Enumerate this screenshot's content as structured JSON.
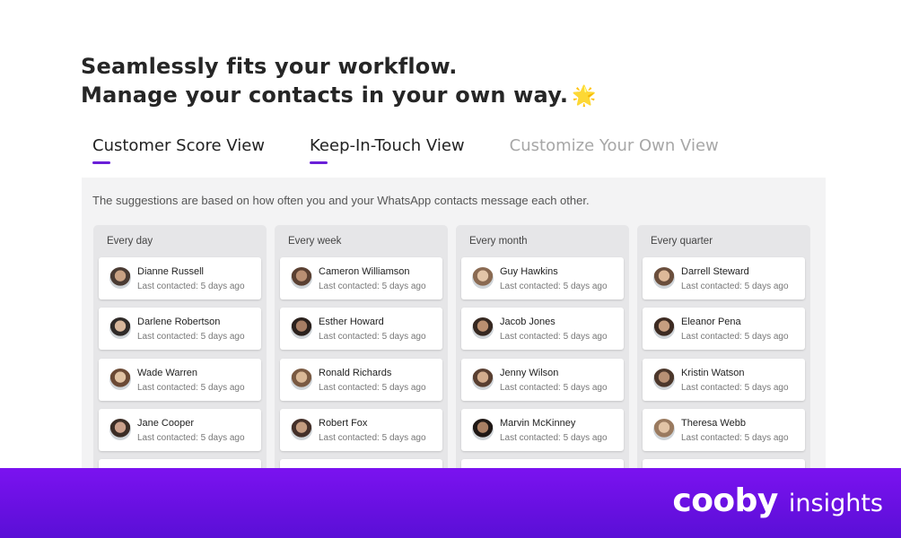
{
  "headline": {
    "line1": "Seamlessly fits your workflow.",
    "line2": "Manage your contacts in your own way.",
    "emoji": "🌟"
  },
  "tabs": [
    {
      "label": "Customer Score View",
      "active": true
    },
    {
      "label": "Keep-In-Touch View",
      "active": true
    },
    {
      "label": "Customize Your Own View",
      "active": false
    }
  ],
  "panel": {
    "note": "The suggestions are based on how often you and your WhatsApp contacts message each other.",
    "columns": [
      {
        "title": "Every day",
        "contacts": [
          {
            "name": "Dianne Russell",
            "status": "Last contacted: 5 days ago"
          },
          {
            "name": "Darlene Robertson",
            "status": "Last contacted: 5 days ago"
          },
          {
            "name": "Wade Warren",
            "status": "Last contacted: 5 days ago"
          },
          {
            "name": "Jane Cooper",
            "status": "Last contacted: 5 days ago"
          }
        ]
      },
      {
        "title": "Every week",
        "contacts": [
          {
            "name": "Cameron Williamson",
            "status": "Last contacted: 5 days ago"
          },
          {
            "name": "Esther Howard",
            "status": "Last contacted: 5 days ago"
          },
          {
            "name": "Ronald Richards",
            "status": "Last contacted: 5 days ago"
          },
          {
            "name": "Robert Fox",
            "status": "Last contacted: 5 days ago"
          }
        ]
      },
      {
        "title": "Every month",
        "contacts": [
          {
            "name": "Guy Hawkins",
            "status": "Last contacted: 5 days ago"
          },
          {
            "name": "Jacob Jones",
            "status": "Last contacted: 5 days ago"
          },
          {
            "name": "Jenny Wilson",
            "status": "Last contacted: 5 days ago"
          },
          {
            "name": "Marvin McKinney",
            "status": "Last contacted: 5 days ago"
          }
        ]
      },
      {
        "title": "Every quarter",
        "contacts": [
          {
            "name": "Darrell Steward",
            "status": "Last contacted: 5 days ago"
          },
          {
            "name": "Eleanor Pena",
            "status": "Last contacted: 5 days ago"
          },
          {
            "name": "Kristin Watson",
            "status": "Last contacted: 5 days ago"
          },
          {
            "name": "Theresa Webb",
            "status": "Last contacted: 5 days ago"
          }
        ]
      }
    ]
  },
  "footer": {
    "brand_name": "cooby",
    "brand_suffix": "insights"
  },
  "colors": {
    "accent": "#6a1fd8",
    "footer": "#6a12e6",
    "panel": "#f3f3f4",
    "column": "#e6e6e8"
  },
  "icons": [
    "star-emoji-icon",
    "avatar-photo-icon"
  ]
}
